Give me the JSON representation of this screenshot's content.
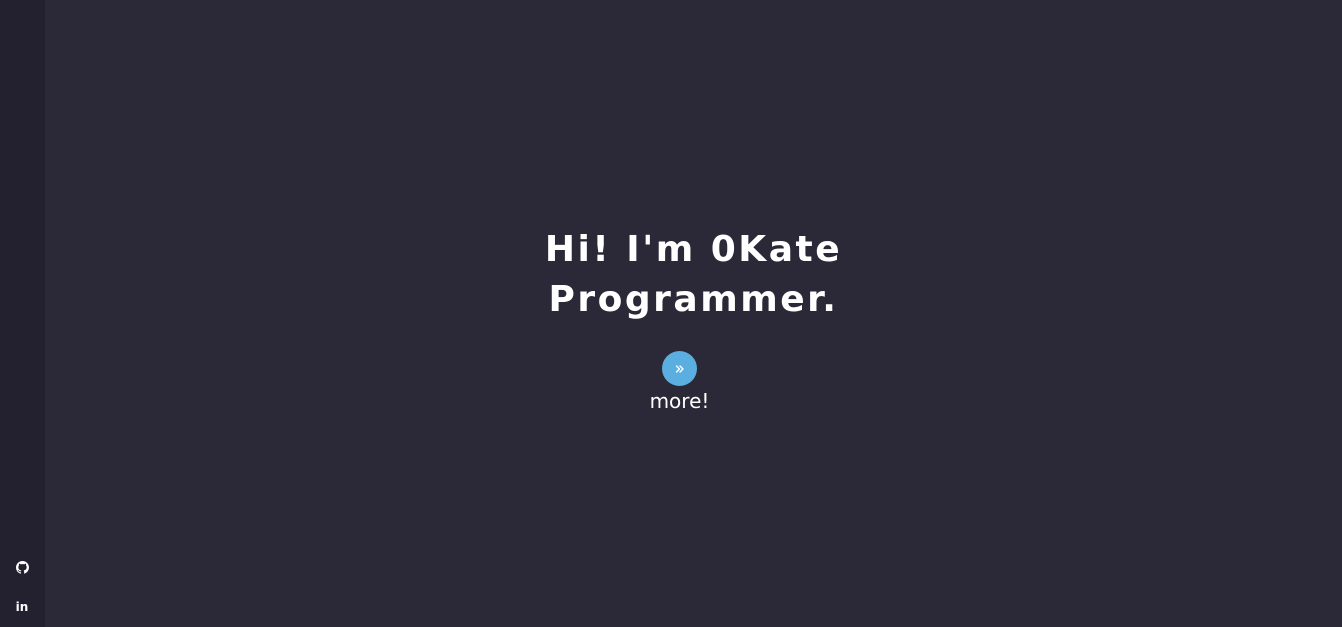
{
  "hero": {
    "line1": "Hi! I'm 0Kate",
    "line2": "Programmer.",
    "more_label": "more!"
  },
  "sidebar": {
    "linkedin_label": "in"
  },
  "colors": {
    "background": "#2b2937",
    "sidebar": "#232130",
    "accent": "#5aafe0",
    "text": "#ffffff"
  },
  "icons": {
    "more_button": "double-chevron-right-icon",
    "github": "github-icon",
    "linkedin": "linkedin-icon"
  }
}
